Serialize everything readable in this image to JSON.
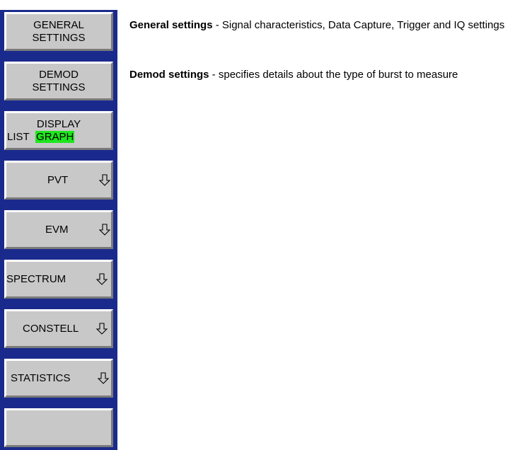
{
  "softkeys": {
    "general": {
      "line1": "GENERAL",
      "line2": "SETTINGS"
    },
    "demod": {
      "line1": "DEMOD",
      "line2": "SETTINGS"
    },
    "display": {
      "line1": "DISPLAY",
      "list": "LIST",
      "graph": "GRAPH"
    },
    "pvt": {
      "label": "PVT",
      "icon": "submenu-arrow-icon"
    },
    "evm": {
      "label": "EVM",
      "icon": "submenu-arrow-icon"
    },
    "spectrum": {
      "label": "SPECTRUM",
      "icon": "submenu-arrow-icon"
    },
    "constell": {
      "label": "CONSTELL",
      "icon": "submenu-arrow-icon"
    },
    "statistics": {
      "label": "STATISTICS",
      "icon": "submenu-arrow-icon"
    },
    "blank": {
      "label": ""
    }
  },
  "descriptions": {
    "general": {
      "title": "General settings",
      "text": " - Signal characteristics, Data Capture, Trigger and IQ settings"
    },
    "demod": {
      "title": "Demod settings",
      "text": " - specifies details about the type of burst to measure"
    }
  },
  "colors": {
    "panel": "#1a2a8c",
    "softkey": "#c8c8c8",
    "highlight": "#1ee61e"
  }
}
